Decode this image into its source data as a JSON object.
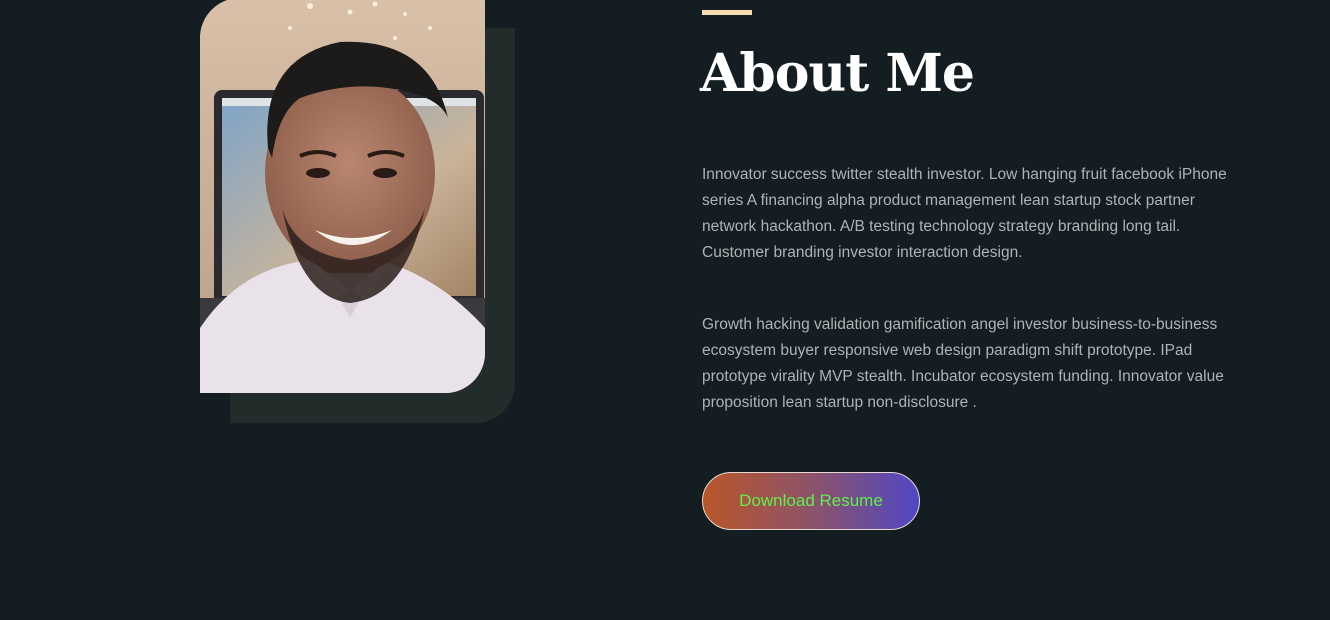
{
  "about": {
    "heading": "About Me",
    "paragraphs": [
      "Innovator success twitter stealth investor. Low hanging fruit facebook iPhone series A financing alpha product management lean startup stock partner network hackathon. A/B testing technology strategy branding long tail. Customer branding investor interaction design.",
      "Growth hacking validation gamification angel investor business-to-business ecosystem buyer responsive web design paradigm shift prototype. IPad prototype virality MVP stealth. Incubator ecosystem funding. Innovator value proposition lean startup non-disclosure ."
    ],
    "button_label": "Download Resume"
  },
  "colors": {
    "background": "#141d21",
    "accent": "#f6dcb2",
    "heading": "#ffffff",
    "body_text": "#aeb4b6",
    "button_gradient_start": "#b8562a",
    "button_gradient_end": "#5047c4",
    "button_text": "#5ff04a"
  }
}
